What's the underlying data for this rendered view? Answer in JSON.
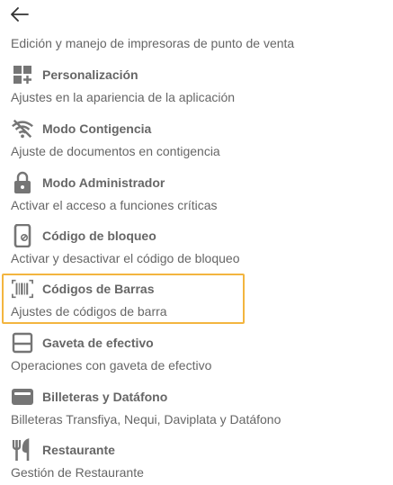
{
  "header": {
    "back_icon": "arrow-left-icon",
    "intro": "Edición y manejo de impresoras de punto de venta"
  },
  "items": [
    {
      "icon": "dashboard-add-icon",
      "title": "Personalización",
      "subtitle": "Ajustes en la apariencia de la aplicación"
    },
    {
      "icon": "wifi-off-icon",
      "title": "Modo Contigencia",
      "subtitle": "Ajuste de documentos en contigencia"
    },
    {
      "icon": "lock-icon",
      "title": "Modo Administrador",
      "subtitle": "Activar el acceso a funciones críticas"
    },
    {
      "icon": "phone-lock-icon",
      "title": "Código de bloqueo",
      "subtitle": "Activar y desactivar el código de bloqueo"
    },
    {
      "icon": "barcode-scan-icon",
      "title": "Códigos de Barras",
      "subtitle": "Ajustes de códigos de barra",
      "selected": true
    },
    {
      "icon": "drawer-icon",
      "title": "Gaveta de efectivo",
      "subtitle": "Operaciones con gaveta de efectivo"
    },
    {
      "icon": "wallet-icon",
      "title": "Billeteras y Datáfono",
      "subtitle": "Billeteras Transfiya, Nequi, Daviplata y Datáfono"
    },
    {
      "icon": "restaurant-icon",
      "title": "Restaurante",
      "subtitle": "Gestión de Restaurante"
    }
  ],
  "colors": {
    "selected_border": "#f3b53f",
    "icon": "#757575",
    "text": "#666666"
  }
}
